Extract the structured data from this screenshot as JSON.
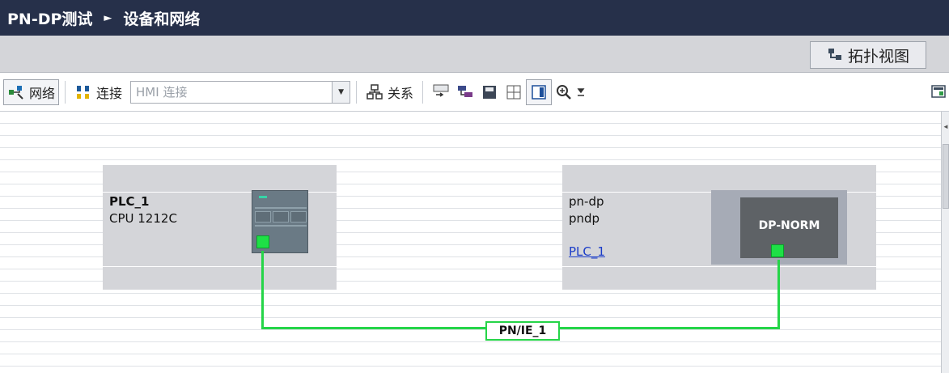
{
  "breadcrumb": {
    "project": "PN-DP测试",
    "separator": "►",
    "page": "设备和网络"
  },
  "view_switch": {
    "label": "拓扑视图",
    "icon": "topology-icon"
  },
  "toolbar": {
    "network_label": "网络",
    "connections_label": "连接",
    "connection_type_value": "HMI 连接",
    "relations_label": "关系",
    "icons": [
      "network-icon",
      "connections-icon",
      "relations-icon",
      "name-icon",
      "network-data-icon",
      "save-icon",
      "grid-icon",
      "panel-icon",
      "zoom-icon"
    ]
  },
  "devices": {
    "plc": {
      "name": "PLC_1",
      "type": "CPU 1212C"
    },
    "dp": {
      "name": "pn-dp",
      "type": "pndp",
      "assigned_to": "PLC_1",
      "module_label": "DP-NORM"
    }
  },
  "network": {
    "subnet_label": "PN/IE_1",
    "color": "#25d548"
  },
  "colors": {
    "titlebar": "#26304a",
    "station_bg": "#d4d5d9",
    "link": "#1a3cc8"
  }
}
